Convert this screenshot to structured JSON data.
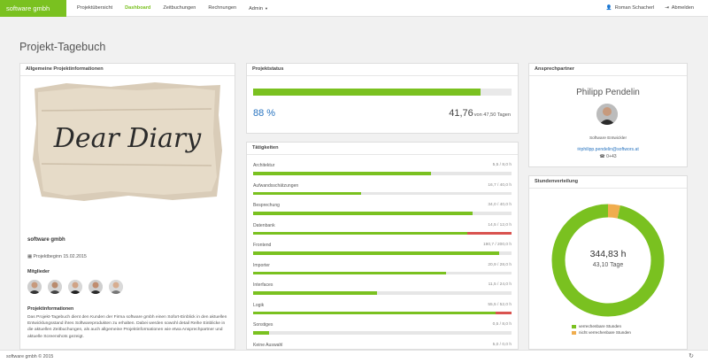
{
  "nav": {
    "brand": "software gmbh",
    "items": [
      {
        "label": "Projektübersicht",
        "active": false
      },
      {
        "label": "Dashboard",
        "active": true
      },
      {
        "label": "Zeitbuchungen",
        "active": false
      },
      {
        "label": "Rechnungen",
        "active": false
      }
    ],
    "admin_label": "Admin",
    "user_name": "Roman Schacherl",
    "logout_label": "Abmelden"
  },
  "page": {
    "title": "Projekt-Tagebuch"
  },
  "project_info": {
    "heading": "Allgemeine Projektinformationen",
    "image_text": "Dear Diary",
    "company": "software gmbh",
    "start_date": "Projektbeginn 15.02.2015",
    "members_label": "Mitglieder",
    "info_label": "Projektinformationen",
    "info_text": "Das Projekt-Tagebuch dient den Kunden der Firma software gmbh einen Sofort-Einblick in den aktuellen Entwicklungsstand ihres Softwareprodukten zu erhalten. Dabei werden sowohl detail Reihe Einblicke in die aktuellen Zeitbuchungen, als auch allgemeine Projektinformationen wie etwa Ansprechpartner und aktuelle Screenshots gezeigt."
  },
  "project_status": {
    "heading": "Projektstatus",
    "percent_label": "88 %",
    "percent": 88,
    "hours_value": "41,76",
    "hours_suffix": "von 47,50 Tagen"
  },
  "activities": {
    "heading": "Tätigkeiten",
    "items": [
      {
        "name": "Architektur",
        "hours": "5,5 / 8,0 h",
        "fill": 68.75,
        "over": 0
      },
      {
        "name": "Aufwandsschätzungen",
        "hours": "16,7 / 40,0 h",
        "fill": 41.75,
        "over": 0
      },
      {
        "name": "Besprechung",
        "hours": "34,0 / 40,0 h",
        "fill": 85,
        "over": 0
      },
      {
        "name": "Datenbank",
        "hours": "14,5 / 12,0 h",
        "fill": 82.8,
        "over": 17.2
      },
      {
        "name": "Frontend",
        "hours": "190,7 / 200,0 h",
        "fill": 95.35,
        "over": 0
      },
      {
        "name": "Importer",
        "hours": "20,9 / 28,0 h",
        "fill": 74.6,
        "over": 0
      },
      {
        "name": "Interfaces",
        "hours": "11,5 / 24,0 h",
        "fill": 47.9,
        "over": 0
      },
      {
        "name": "Logik",
        "hours": "55,5 / 52,0 h",
        "fill": 93.7,
        "over": 6.3
      },
      {
        "name": "Sonstiges",
        "hours": "0,5 / 8,0 h",
        "fill": 6.25,
        "over": 0
      },
      {
        "name": "Keine Auswahl",
        "hours": "5,0 / 0,0 h",
        "fill": 0,
        "over": 0
      }
    ]
  },
  "contact": {
    "heading": "Ansprechpartner",
    "name": "Philipp Pendelin",
    "role": "Software Entwickler",
    "email": "philipp.pendelin@softwors.at",
    "phone": "0+43"
  },
  "hours_distribution": {
    "heading": "Stundenverteilung",
    "total_hours": "344,83 h",
    "total_days": "43,10 Tage",
    "legend": [
      {
        "label": "verrechenbare Stunden",
        "color": "#7ac120"
      },
      {
        "label": "nicht verrechenbare Stunden",
        "color": "#f0ad4e"
      }
    ]
  },
  "chart_data": {
    "type": "pie",
    "categories": [
      "verrechenbare Stunden",
      "nicht verrechenbare Stunden"
    ],
    "values": [
      96.5,
      3.5
    ]
  },
  "footer": {
    "text": "software gmbh © 2015"
  },
  "colors": {
    "accent": "#7ac120",
    "over": "#d9534f",
    "link": "#2a75c0",
    "nonbillable": "#f0ad4e"
  }
}
